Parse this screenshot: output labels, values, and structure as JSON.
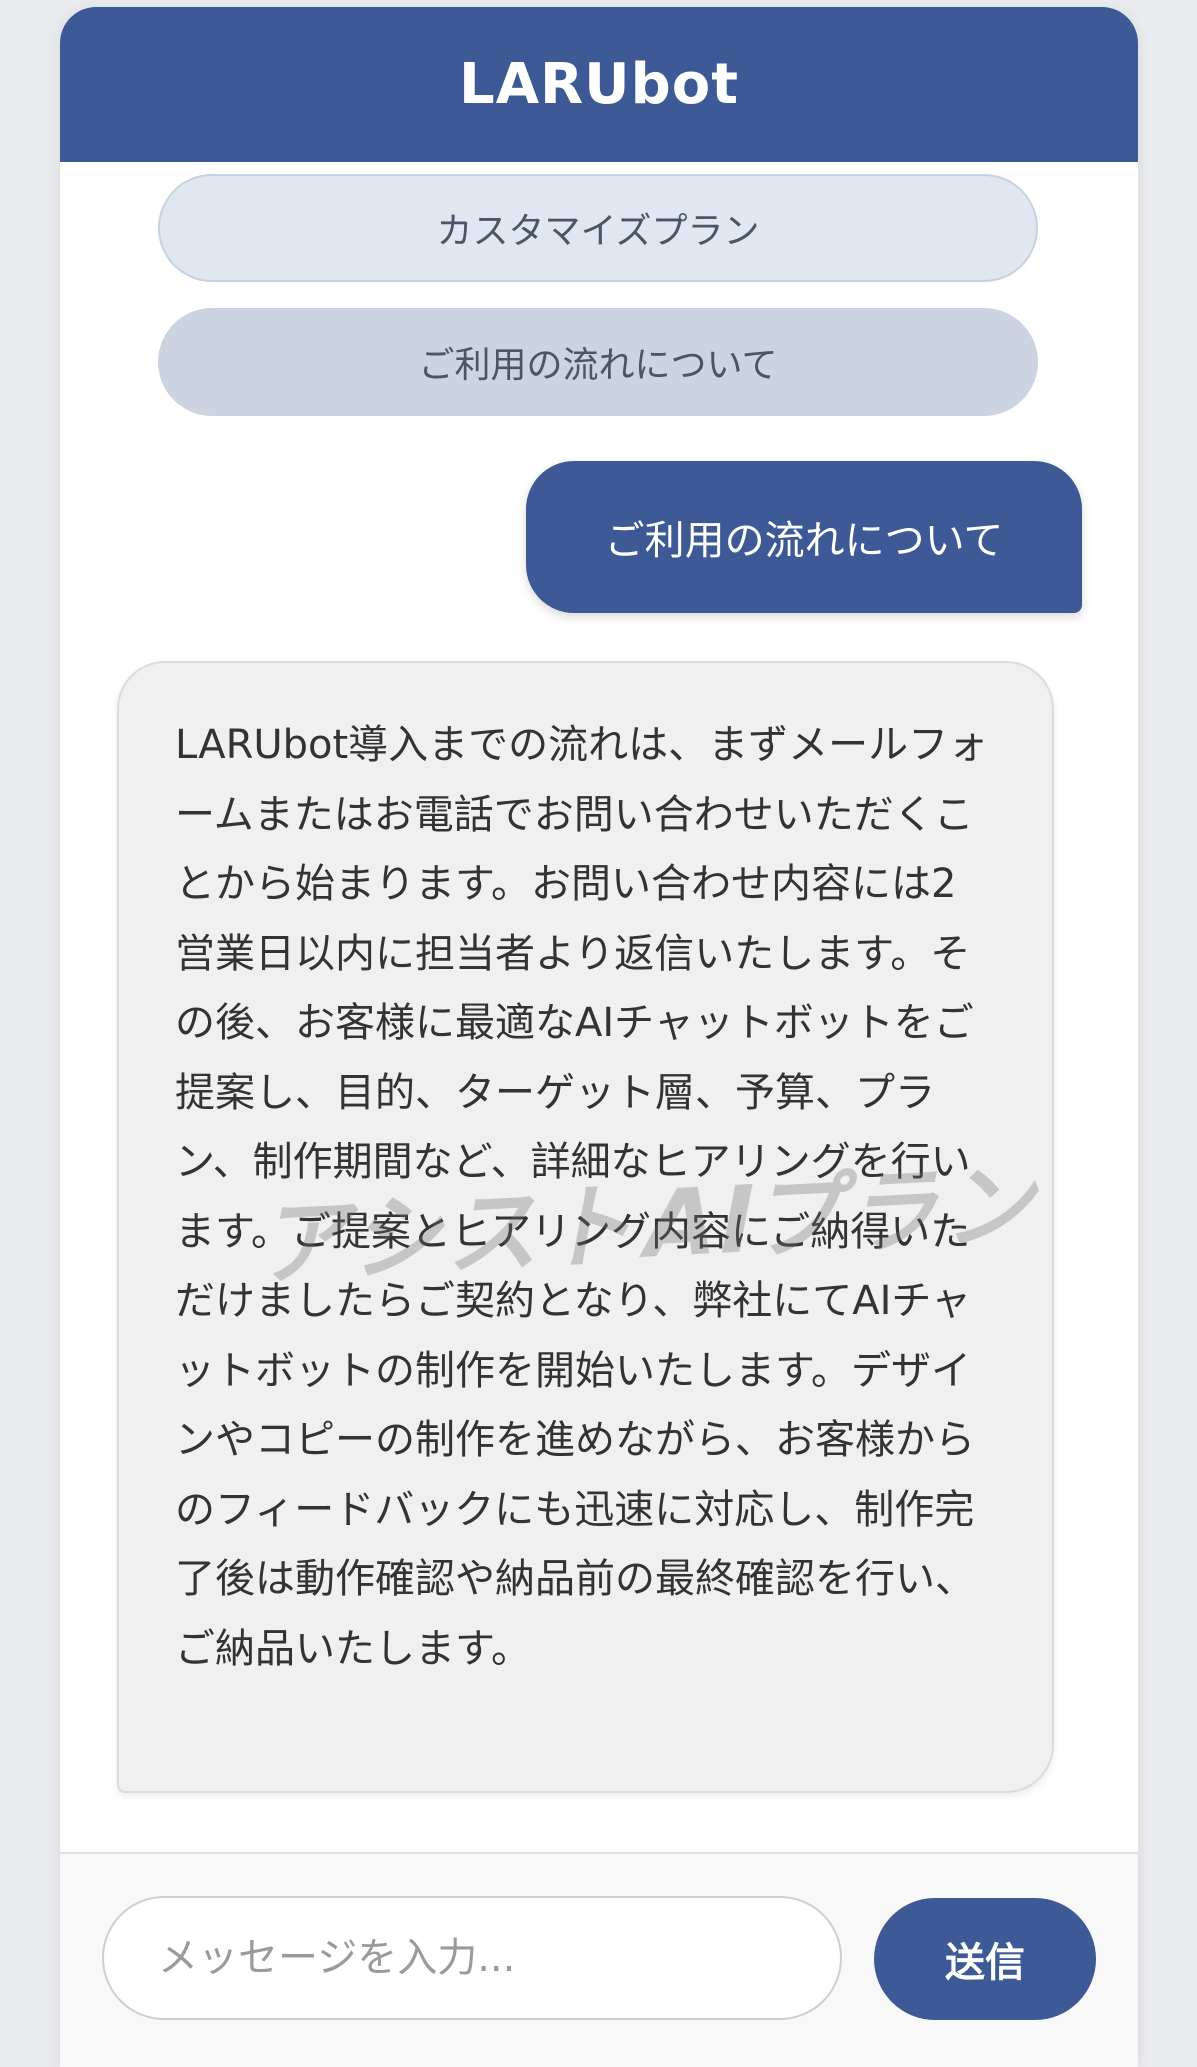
{
  "header": {
    "title": "LARUbot"
  },
  "options": [
    {
      "label": "カスタマイズプラン"
    },
    {
      "label": "ご利用の流れについて"
    }
  ],
  "user_message": {
    "text": "ご利用の流れについて"
  },
  "bot_message": {
    "text": "LARUbot導入までの流れは、まずメールフォームまたはお電話でお問い合わせいただくことから始まります。お問い合わせ内容には2営業日以内に担当者より返信いたします。その後、お客様に最適なAIチャットボットをご提案し、目的、ターゲット層、予算、プラン、制作期間など、詳細なヒアリングを行います。ご提案とヒアリング内容にご納得いただけましたらご契約となり、弊社にてAIチャットボットの制作を開始いたします。デザインやコピーの制作を進めながら、お客様からのフィードバックにも迅速に対応し、制作完了後は動作確認や納品前の最終確認を行い、ご納品いたします。"
  },
  "watermark": {
    "text": "アシストAIプラン"
  },
  "composer": {
    "placeholder": "メッセージを入力...",
    "send_label": "送信"
  },
  "colors": {
    "brand": "#3d5a96",
    "option_light": "#e1e7f1",
    "option_dark": "#cbd4e0",
    "bot_bubble": "#f0f0f0"
  }
}
